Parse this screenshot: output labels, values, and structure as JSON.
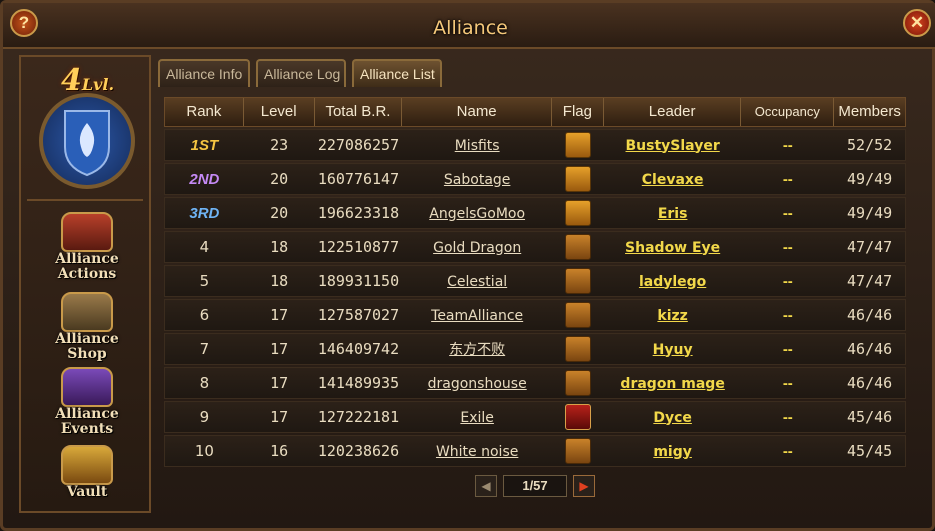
{
  "window": {
    "title": "Alliance"
  },
  "sidebar": {
    "level_number": "4",
    "level_suffix": "Lvl.",
    "items": [
      {
        "label_line1": "Alliance",
        "label_line2": "Actions",
        "icon": "alliance-actions-icon"
      },
      {
        "label_line1": "Alliance",
        "label_line2": "Shop",
        "icon": "alliance-shop-icon"
      },
      {
        "label_line1": "Alliance",
        "label_line2": "Events",
        "icon": "alliance-events-icon"
      },
      {
        "label_line1": "Vault",
        "label_line2": "",
        "icon": "vault-icon"
      }
    ]
  },
  "tabs": [
    {
      "label": "Alliance Info",
      "active": false
    },
    {
      "label": "Alliance Log",
      "active": false
    },
    {
      "label": "Alliance List",
      "active": true
    }
  ],
  "table": {
    "headers": [
      "Rank",
      "Level",
      "Total B.R.",
      "Name",
      "Flag",
      "Leader",
      "Occupancy",
      "Members"
    ],
    "rows": [
      {
        "rank": "1ST",
        "level": "23",
        "br": "227086257",
        "name": "Misfits",
        "flag": "gold",
        "leader": "BustySlayer",
        "occupancy": "--",
        "members": "52/52"
      },
      {
        "rank": "2ND",
        "level": "20",
        "br": "160776147",
        "name": "Sabotage",
        "flag": "gold",
        "leader": "Clevaxe",
        "occupancy": "--",
        "members": "49/49"
      },
      {
        "rank": "3RD",
        "level": "20",
        "br": "196623318",
        "name": "AngelsGoMoo",
        "flag": "gold",
        "leader": "Eris",
        "occupancy": "--",
        "members": "49/49"
      },
      {
        "rank": "4",
        "level": "18",
        "br": "122510877",
        "name": "Gold Dragon",
        "flag": "bronze",
        "leader": "Shadow Eye",
        "occupancy": "--",
        "members": "47/47"
      },
      {
        "rank": "5",
        "level": "18",
        "br": "189931150",
        "name": "Celestial",
        "flag": "bronze",
        "leader": "ladylego",
        "occupancy": "--",
        "members": "47/47"
      },
      {
        "rank": "6",
        "level": "17",
        "br": "127587027",
        "name": "TeamAlliance",
        "flag": "bronze",
        "leader": "kizz",
        "occupancy": "--",
        "members": "46/46"
      },
      {
        "rank": "7",
        "level": "17",
        "br": "146409742",
        "name": "东方不败",
        "flag": "bronze",
        "leader": "Hyuy",
        "occupancy": "--",
        "members": "46/46"
      },
      {
        "rank": "8",
        "level": "17",
        "br": "141489935",
        "name": "dragonshouse",
        "flag": "bronze",
        "leader": "dragon mage",
        "occupancy": "--",
        "members": "46/46"
      },
      {
        "rank": "9",
        "level": "17",
        "br": "127222181",
        "name": "Exile",
        "flag": "red",
        "leader": "Dyce",
        "occupancy": "--",
        "members": "45/46"
      },
      {
        "rank": "10",
        "level": "16",
        "br": "120238626",
        "name": "White noise",
        "flag": "bronze",
        "leader": "migy",
        "occupancy": "--",
        "members": "45/45"
      }
    ]
  },
  "pagination": {
    "display": "1/57",
    "current": 1,
    "total": 57
  },
  "colors": {
    "accent_gold": "#f2d84a",
    "first": "#f5c542",
    "second": "#c58af5",
    "third": "#6fb4f5"
  }
}
